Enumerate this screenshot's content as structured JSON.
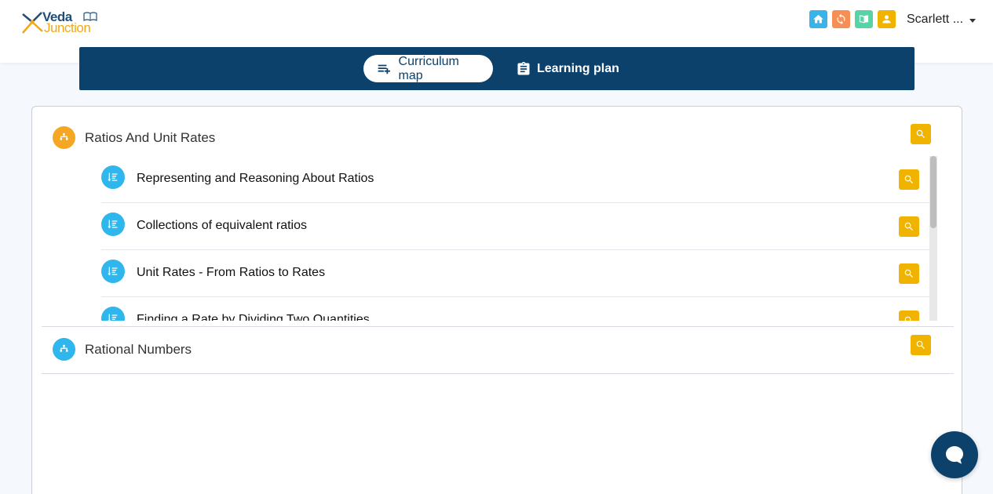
{
  "header": {
    "logo": {
      "line1": "Veda",
      "line2": "Junction"
    },
    "icons": [
      {
        "name": "home-icon",
        "color": "#3ab3e8"
      },
      {
        "name": "refresh-icon",
        "color": "#f58f55"
      },
      {
        "name": "book-icon",
        "color": "#58d3a6"
      },
      {
        "name": "person-icon",
        "color": "#f0b400"
      }
    ],
    "user_name": "Scarlett ..."
  },
  "tabs": [
    {
      "label": "Curriculum map",
      "icon": "playlist-add-icon",
      "active": true
    },
    {
      "label": "Learning plan",
      "icon": "clipboard-icon",
      "active": false
    }
  ],
  "units": [
    {
      "title": "Ratios And Unit Rates",
      "icon_color": "#f5a623",
      "expanded": true,
      "lessons": [
        {
          "title": "Representing and Reasoning About Ratios"
        },
        {
          "title": "Collections of equivalent ratios"
        },
        {
          "title": "Unit Rates - From Ratios to Rates"
        },
        {
          "title": "Finding a Rate by Dividing Two Quantities"
        }
      ]
    },
    {
      "title": "Rational Numbers",
      "icon_color": "#2fb6ec",
      "expanded": false,
      "lessons": []
    }
  ],
  "colors": {
    "navy": "#0c416c",
    "accent_yellow": "#f0b400",
    "lesson_blue": "#2fb6ec"
  }
}
